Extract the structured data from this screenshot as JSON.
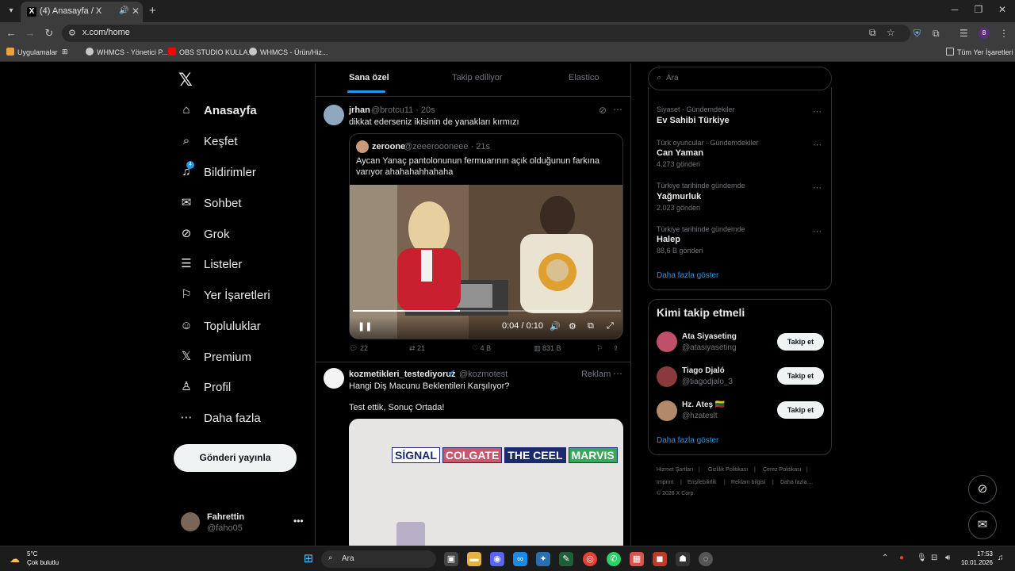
{
  "browser": {
    "tab_title": "(4) Anasayfa / X",
    "url": "x.com/home",
    "profile_initial": "8",
    "bookmarks": [
      "Uygulamalar",
      "WHMCS - Yönetici P...",
      "OBS STUDIO KULLA...",
      "WHMCS - Ürün/Hiz..."
    ],
    "all_bookmarks": "Tüm Yer İşaretleri"
  },
  "nav": {
    "items": [
      {
        "label": "Anasayfa",
        "icon": "home-icon"
      },
      {
        "label": "Keşfet",
        "icon": "search-icon"
      },
      {
        "label": "Bildirimler",
        "icon": "bell-icon"
      },
      {
        "label": "Sohbet",
        "icon": "mail-icon"
      },
      {
        "label": "Grok",
        "icon": "grok-icon"
      },
      {
        "label": "Listeler",
        "icon": "list-icon"
      },
      {
        "label": "Yer İşaretleri",
        "icon": "bookmark-icon"
      },
      {
        "label": "Topluluklar",
        "icon": "people-icon"
      },
      {
        "label": "Premium",
        "icon": "x-icon"
      },
      {
        "label": "Profil",
        "icon": "person-icon"
      },
      {
        "label": "Daha fazla",
        "icon": "more-icon"
      }
    ],
    "notif_count": "4",
    "post_button": "Gönderi yayınla",
    "user": {
      "name": "Fahrettin",
      "handle": "@faho05"
    }
  },
  "feed": {
    "tabs": [
      "Sana özel",
      "Takip ediliyor",
      "Elastico"
    ],
    "tweet1": {
      "name": "jrhan",
      "handle": "@brotcu11 · 20s",
      "text": "dikkat ederseniz ikisinin de yanakları kırmızı",
      "quote": {
        "name": "zeroone",
        "handle": "@zeeeroooneee · 21s",
        "text": "Aycan Yanaç pantolonunun fermuarının açık olduğunun farkına varıyor ahahahahhahaha"
      },
      "video": {
        "time": "0:04 / 0:10",
        "progress": 0.4
      },
      "stats": {
        "replies": "22",
        "reposts": "21",
        "likes": "4 B",
        "views": "831 B"
      }
    },
    "tweet2": {
      "name": "kozmetikleri_testediyoruz",
      "handle": "@kozmotest",
      "badge": "Reklam",
      "title": "Hangi Diş Macunu Beklentileri Karşılıyor?",
      "text": "Test ettik, Sonuç Ortada!",
      "brands": [
        {
          "label": "SİGNAL",
          "color": "#1a2a6c",
          "bg": "#ffffff"
        },
        {
          "label": "COLGATE",
          "color": "#ffffff",
          "bg": "#c9566a"
        },
        {
          "label": "THE CEEL",
          "color": "#ffffff",
          "bg": "#1a2a6c"
        },
        {
          "label": "MARVIS",
          "color": "#ffffff",
          "bg": "#3aa65a"
        }
      ]
    }
  },
  "sidebar": {
    "search_placeholder": "Ara",
    "trends": [
      {
        "context": "Siyaset · Gündemdekiler",
        "title": "Ev Sahibi Türkiye",
        "count": ""
      },
      {
        "context": "Türk oyuncular · Gündemdekiler",
        "title": "Can Yaman",
        "count": "4.273 gönderi"
      },
      {
        "context": "Türkiye tarihinde gündemde",
        "title": "Yağmurluk",
        "count": "2.023 gönderi"
      },
      {
        "context": "Türkiye tarihinde gündemde",
        "title": "Halep",
        "count": "88,6 B gönderi"
      }
    ],
    "trends_more": "Daha fazla göster",
    "who_title": "Kimi takip etmeli",
    "who": [
      {
        "name": "Ata Siyaseting",
        "handle": "@atasiyaseting",
        "button": "Takip et"
      },
      {
        "name": "Tiago Djaló",
        "handle": "@tiagodjalo_3",
        "button": "Takip et"
      },
      {
        "name": "Hz. Ateş 🇱🇹",
        "handle": "@hzateslt",
        "button": "Takip et"
      }
    ],
    "who_more": "Daha fazla göster",
    "footer": [
      "Hizmet Şartları",
      "Gizlilik Politikası",
      "Çerez Politikası",
      "Imprint",
      "Erişilebilirlik",
      "Reklam bilgisi",
      "Daha fazla ...",
      "© 2026 X Corp."
    ]
  },
  "taskbar": {
    "temp": "5°C",
    "condition": "Çok bulutlu",
    "search": "Ara",
    "time": "17:53",
    "date": "10.01.2026"
  },
  "colors": {
    "accent": "#1d9bf0",
    "bg": "#000000",
    "border": "#2f3336",
    "muted": "#71767b"
  }
}
